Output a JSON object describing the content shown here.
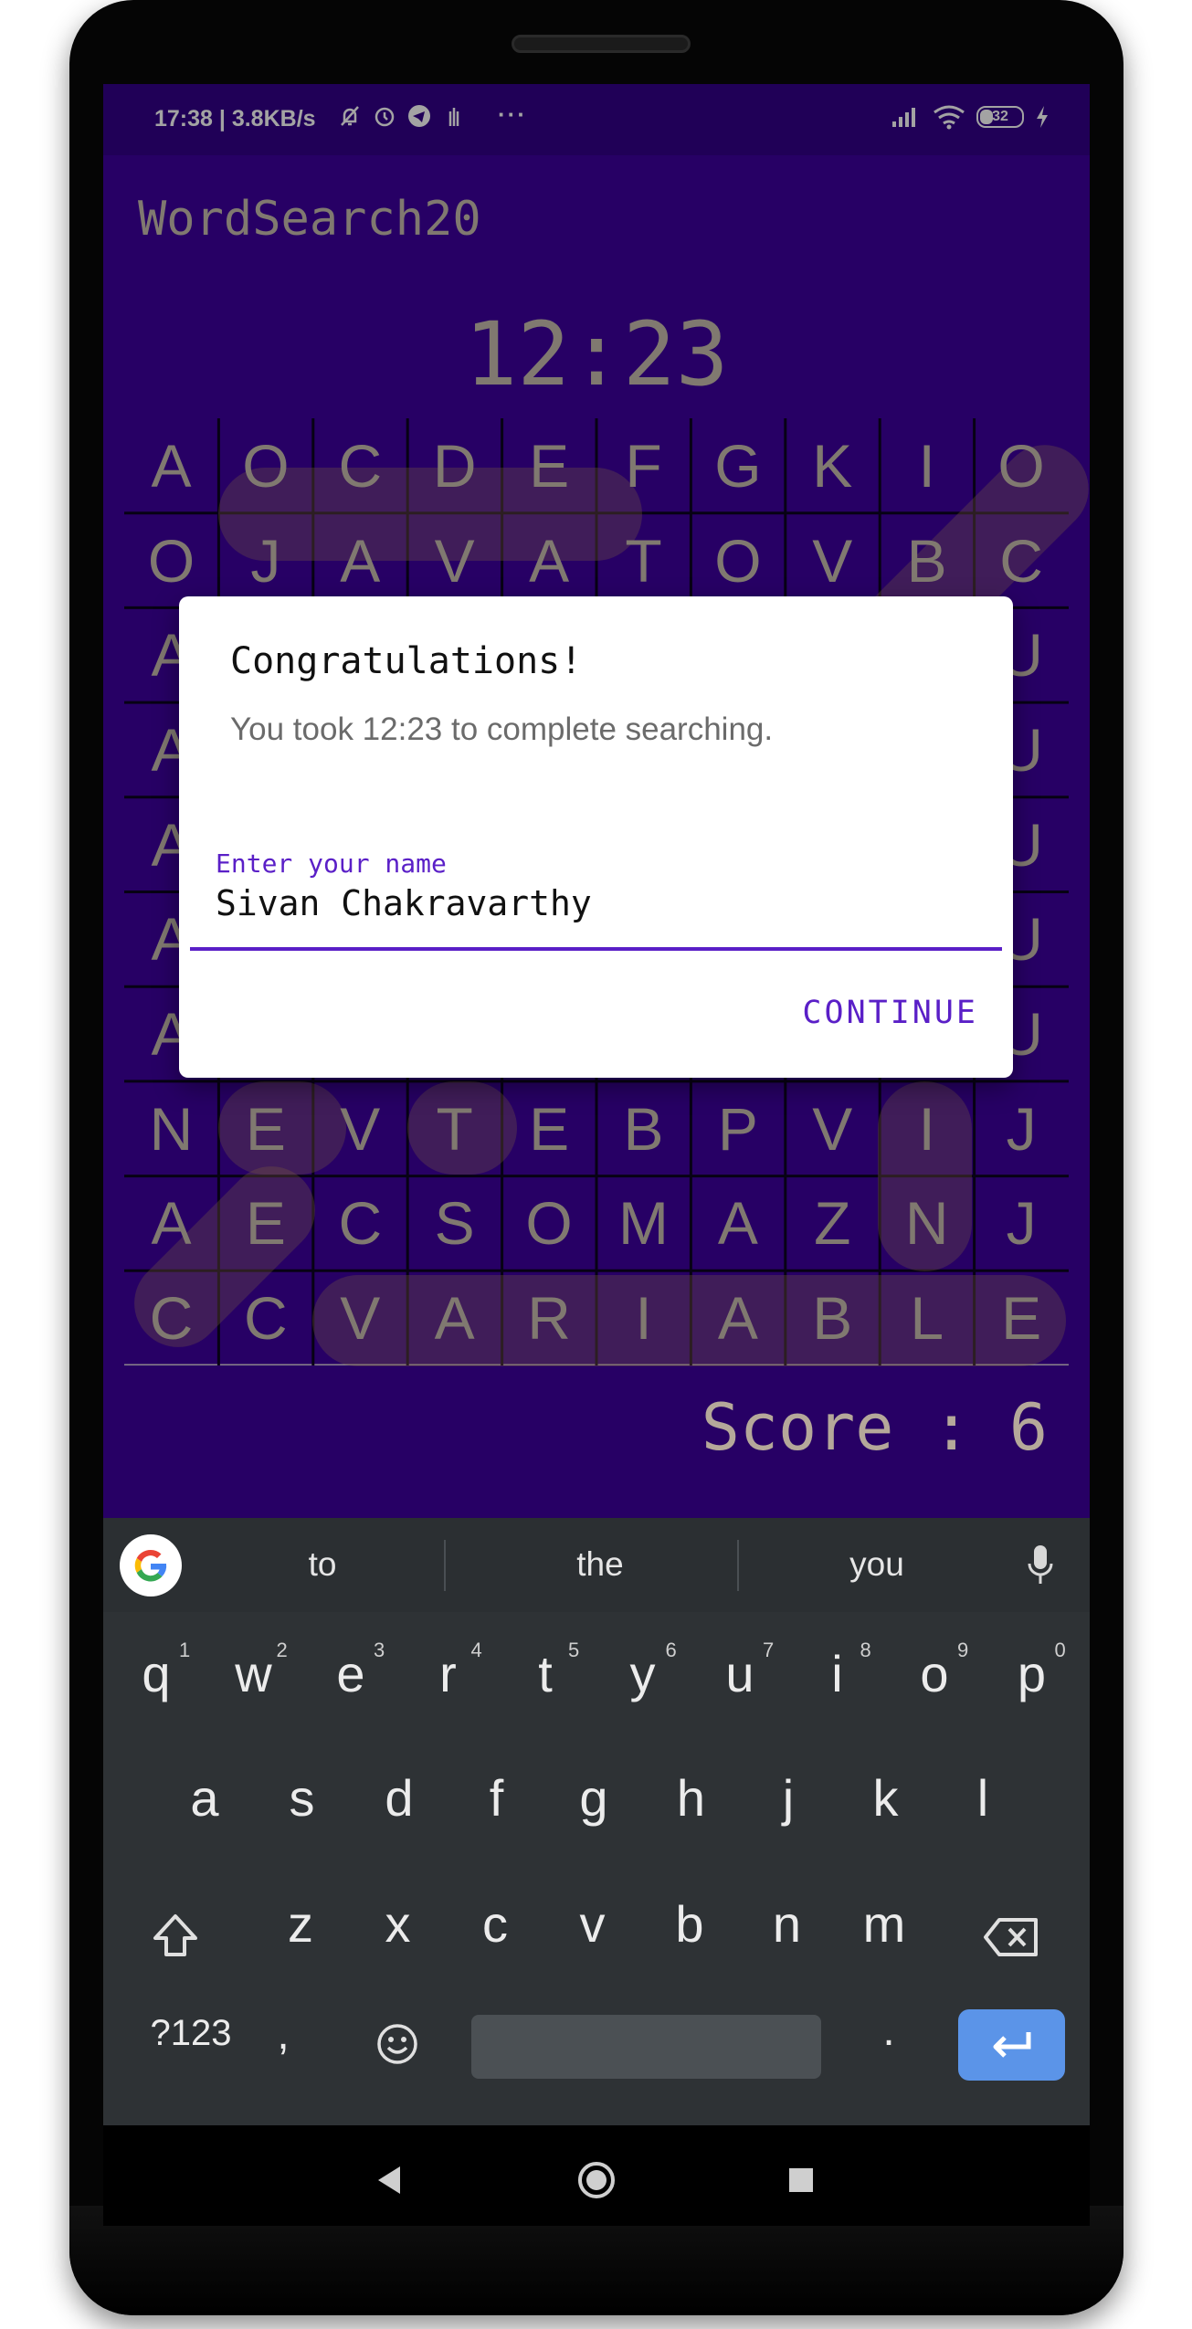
{
  "status_bar": {
    "time_speed": "17:38 | 3.8KB/s",
    "more": "···",
    "battery": "32",
    "icons": [
      "mute-bell-icon",
      "alarm-icon",
      "telegram-icon",
      "gesture-icon",
      "signal-icon",
      "wifi-icon",
      "battery-icon",
      "charging-bolt-icon"
    ]
  },
  "app": {
    "title": "WordSearch20",
    "timer": "12:23",
    "score": "Score : 6",
    "grid": [
      [
        "A",
        "O",
        "C",
        "D",
        "E",
        "F",
        "G",
        "K",
        "I",
        "O"
      ],
      [
        "O",
        "J",
        "A",
        "V",
        "A",
        "T",
        "O",
        "V",
        "B",
        "C"
      ],
      [
        "A",
        "",
        "",
        "",
        "",
        "",
        "",
        "",
        "",
        "U"
      ],
      [
        "A",
        "",
        "",
        "",
        "",
        "",
        "",
        "",
        "",
        "U"
      ],
      [
        "A",
        "",
        "",
        "",
        "",
        "",
        "",
        "",
        "",
        "U"
      ],
      [
        "A",
        "",
        "",
        "",
        "",
        "",
        "",
        "",
        "",
        "U"
      ],
      [
        "A",
        "",
        "",
        "",
        "",
        "",
        "",
        "",
        "",
        "U"
      ],
      [
        "N",
        "E",
        "V",
        "T",
        "E",
        "B",
        "P",
        "V",
        "I",
        "J"
      ],
      [
        "A",
        "E",
        "C",
        "S",
        "O",
        "M",
        "A",
        "Z",
        "N",
        "J"
      ],
      [
        "C",
        "C",
        "V",
        "A",
        "R",
        "I",
        "A",
        "B",
        "L",
        "E"
      ]
    ]
  },
  "dialog": {
    "title": "Congratulations!",
    "message": "You took 12:23 to complete searching.",
    "input_label": "Enter your name",
    "input_value": "Sivan Chakravarthy",
    "continue_label": "CONTINUE"
  },
  "keyboard": {
    "suggestions": [
      "to",
      "the",
      "you"
    ],
    "row1": [
      "q",
      "w",
      "e",
      "r",
      "t",
      "y",
      "u",
      "i",
      "o",
      "p"
    ],
    "row1_hints": [
      "1",
      "2",
      "3",
      "4",
      "5",
      "6",
      "7",
      "8",
      "9",
      "0"
    ],
    "row2": [
      "a",
      "s",
      "d",
      "f",
      "g",
      "h",
      "j",
      "k",
      "l"
    ],
    "row3": [
      "z",
      "x",
      "c",
      "v",
      "b",
      "n",
      "m"
    ],
    "symbols_label": "?123",
    "comma": ",",
    "period": ".",
    "accent_color": "#5b94e8"
  },
  "colors": {
    "app_background": "#3d009e",
    "accent": "#5a1fc7",
    "letters": "#c9bdb0"
  }
}
